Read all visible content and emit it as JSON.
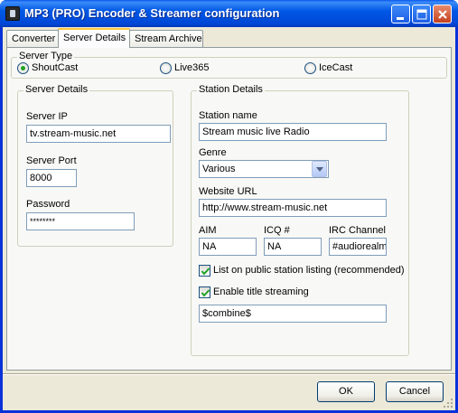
{
  "window": {
    "title": "MP3 (PRO) Encoder & Streamer configuration"
  },
  "tabs": [
    {
      "label": "Converter"
    },
    {
      "label": "Server Details"
    },
    {
      "label": "Stream Archive"
    }
  ],
  "server_type": {
    "legend": "Server Type",
    "options": [
      {
        "label": "ShoutCast",
        "checked": true
      },
      {
        "label": "Live365",
        "checked": false
      },
      {
        "label": "IceCast",
        "checked": false
      }
    ]
  },
  "server_details": {
    "legend": "Server Details",
    "ip_label": "Server IP",
    "ip_value": "tv.stream-music.net",
    "port_label": "Server Port",
    "port_value": "8000",
    "password_label": "Password",
    "password_value": "********"
  },
  "station_details": {
    "legend": "Station Details",
    "name_label": "Station name",
    "name_value": "Stream music live Radio",
    "genre_label": "Genre",
    "genre_value": "Various",
    "url_label": "Website URL",
    "url_value": "http://www.stream-music.net",
    "aim_label": "AIM",
    "aim_value": "NA",
    "icq_label": "ICQ #",
    "icq_value": "NA",
    "irc_label": "IRC Channel",
    "irc_value": "#audiorealm",
    "list_public_label": "List on public station listing (recommended)",
    "list_public_checked": true,
    "title_stream_label": "Enable title streaming",
    "title_stream_checked": true,
    "title_format_value": "$combine$"
  },
  "buttons": {
    "ok": "OK",
    "cancel": "Cancel"
  },
  "icons": [
    "app-icon",
    "minimize-icon",
    "maximize-icon",
    "close-icon",
    "checkmark-icon",
    "dropdown-arrow-icon",
    "resize-grip-icon"
  ],
  "colors": {
    "titlebar": "#0058e6",
    "dialog_bg": "#ece9d8",
    "panel_bg": "#f8f8f6",
    "radio_dot": "#21a121",
    "check_mark": "#21a121"
  }
}
